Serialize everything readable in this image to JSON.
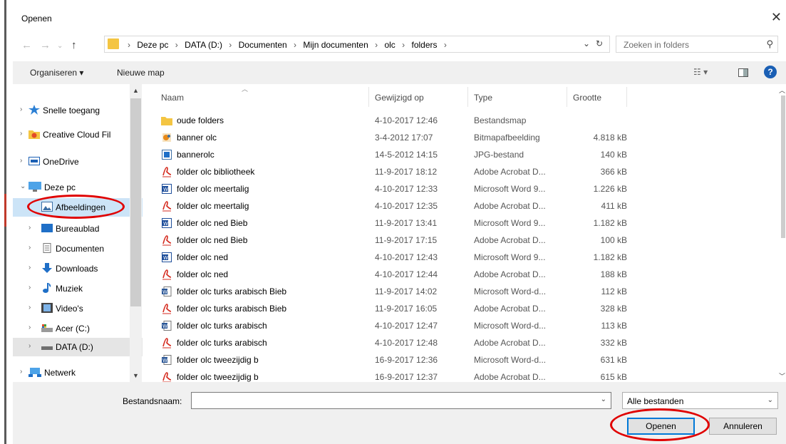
{
  "window": {
    "title": "Openen"
  },
  "address": {
    "crumbs": [
      "Deze pc",
      "DATA (D:)",
      "Documenten",
      "Mijn documenten",
      "olc",
      "folders"
    ],
    "search_placeholder": "Zoeken in folders"
  },
  "toolbar": {
    "organize_label": "Organiseren ▾",
    "new_folder_label": "Nieuwe map"
  },
  "nav": {
    "items": [
      {
        "label": "Snelle toegang",
        "icon": "star-icon"
      },
      {
        "label": "Creative Cloud Fil",
        "icon": "creative-cloud-icon"
      },
      {
        "label": "OneDrive",
        "icon": "onedrive-icon"
      },
      {
        "label": "Deze pc",
        "icon": "pc-icon"
      },
      {
        "label": "Afbeeldingen",
        "icon": "pictures-icon"
      },
      {
        "label": "Bureaublad",
        "icon": "desktop-icon"
      },
      {
        "label": "Documenten",
        "icon": "documents-icon"
      },
      {
        "label": "Downloads",
        "icon": "downloads-icon"
      },
      {
        "label": "Muziek",
        "icon": "music-icon"
      },
      {
        "label": "Video's",
        "icon": "videos-icon"
      },
      {
        "label": "Acer (C:)",
        "icon": "drive-c-icon"
      },
      {
        "label": "DATA (D:)",
        "icon": "drive-d-icon"
      },
      {
        "label": "Netwerk",
        "icon": "network-icon"
      }
    ]
  },
  "files": {
    "columns": [
      "Naam",
      "Gewijzigd op",
      "Type",
      "Grootte"
    ],
    "rows": [
      {
        "name": "oude folders",
        "date": "4-10-2017 12:46",
        "type": "Bestandsmap",
        "size": "",
        "kind": "folder"
      },
      {
        "name": "banner olc",
        "date": "3-4-2012 17:07",
        "type": "Bitmapafbeelding",
        "size": "4.818 kB",
        "kind": "bmp"
      },
      {
        "name": "bannerolc",
        "date": "14-5-2012 14:15",
        "type": "JPG-bestand",
        "size": "140 kB",
        "kind": "jpg"
      },
      {
        "name": "folder olc bibliotheek",
        "date": "11-9-2017 18:12",
        "type": "Adobe Acrobat D...",
        "size": "366 kB",
        "kind": "pdf"
      },
      {
        "name": "folder olc meertalig",
        "date": "4-10-2017 12:33",
        "type": "Microsoft Word 9...",
        "size": "1.226 kB",
        "kind": "doc"
      },
      {
        "name": "folder olc meertalig",
        "date": "4-10-2017 12:35",
        "type": "Adobe Acrobat D...",
        "size": "411 kB",
        "kind": "pdf"
      },
      {
        "name": "folder olc ned Bieb",
        "date": "11-9-2017 13:41",
        "type": "Microsoft Word 9...",
        "size": "1.182 kB",
        "kind": "doc"
      },
      {
        "name": "folder olc ned Bieb",
        "date": "11-9-2017 17:15",
        "type": "Adobe Acrobat D...",
        "size": "100 kB",
        "kind": "pdf"
      },
      {
        "name": "folder olc ned",
        "date": "4-10-2017 12:43",
        "type": "Microsoft Word 9...",
        "size": "1.182 kB",
        "kind": "doc"
      },
      {
        "name": "folder olc ned",
        "date": "4-10-2017 12:44",
        "type": "Adobe Acrobat D...",
        "size": "188 kB",
        "kind": "pdf"
      },
      {
        "name": "folder olc turks arabisch Bieb",
        "date": "11-9-2017 14:02",
        "type": "Microsoft Word-d...",
        "size": "112 kB",
        "kind": "docx"
      },
      {
        "name": "folder olc turks arabisch Bieb",
        "date": "11-9-2017 16:05",
        "type": "Adobe Acrobat D...",
        "size": "328 kB",
        "kind": "pdf"
      },
      {
        "name": "folder olc turks arabisch",
        "date": "4-10-2017 12:47",
        "type": "Microsoft Word-d...",
        "size": "113 kB",
        "kind": "docx"
      },
      {
        "name": "folder olc turks arabisch",
        "date": "4-10-2017 12:48",
        "type": "Adobe Acrobat D...",
        "size": "332 kB",
        "kind": "pdf"
      },
      {
        "name": "folder olc tweezijdig b",
        "date": "16-9-2017 12:36",
        "type": "Microsoft Word-d...",
        "size": "631 kB",
        "kind": "docx"
      },
      {
        "name": "folder olc tweezijdig b",
        "date": "16-9-2017 12:37",
        "type": "Adobe Acrobat D...",
        "size": "615 kB",
        "kind": "pdf"
      }
    ]
  },
  "bottom": {
    "filename_label": "Bestandsnaam:",
    "filename_value": "",
    "filter_value": "Alle bestanden",
    "open_label": "Openen",
    "cancel_label": "Annuleren"
  },
  "colors": {
    "accent": "#0078d7",
    "selection": "#cce4f7",
    "annotation": "#e00000"
  }
}
